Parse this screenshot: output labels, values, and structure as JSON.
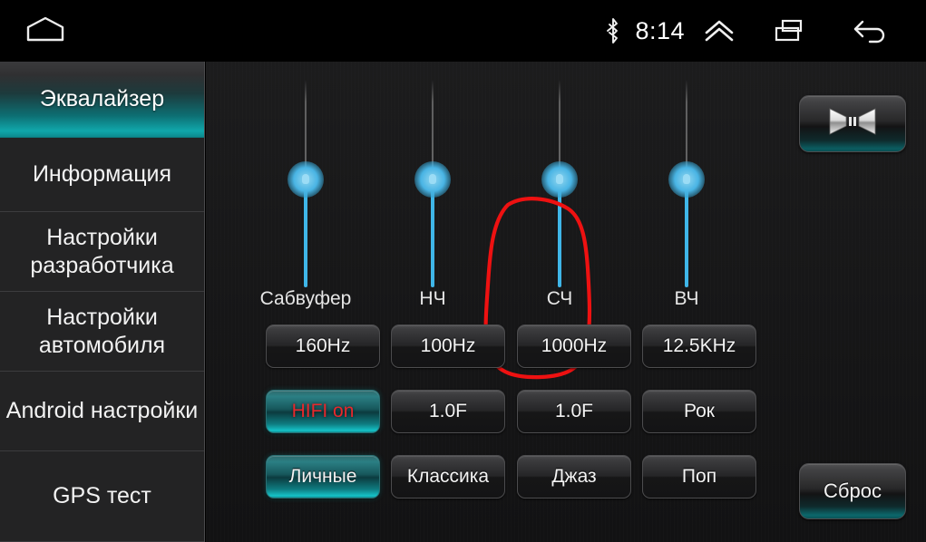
{
  "statusbar": {
    "home_icon": "home-icon",
    "bluetooth_icon": "bluetooth-icon",
    "time": "8:14",
    "expand_icon": "chevron-up-icon",
    "recents_icon": "recents-icon",
    "back_icon": "back-icon"
  },
  "sidebar": {
    "items": [
      {
        "label": "Эквалайзер",
        "active": true
      },
      {
        "label": "Информация",
        "active": false
      },
      {
        "label": "Настройки разработчика",
        "active": false
      },
      {
        "label": "Настройки автомобиля",
        "active": false
      },
      {
        "label": "Android настройки",
        "active": false
      },
      {
        "label": "GPS тест",
        "active": false
      }
    ]
  },
  "main": {
    "sliders": [
      {
        "label": "Сабвуфер",
        "annotated": true
      },
      {
        "label": "НЧ",
        "annotated": false
      },
      {
        "label": "СЧ",
        "annotated": false
      },
      {
        "label": "ВЧ",
        "annotated": false
      }
    ],
    "button_rows": [
      [
        {
          "label": "160Hz",
          "state": "normal"
        },
        {
          "label": "100Hz",
          "state": "normal"
        },
        {
          "label": "1000Hz",
          "state": "normal"
        },
        {
          "label": "12.5KHz",
          "state": "normal"
        }
      ],
      [
        {
          "label": "HIFI on",
          "state": "on-red"
        },
        {
          "label": "1.0F",
          "state": "normal"
        },
        {
          "label": "1.0F",
          "state": "normal"
        },
        {
          "label": "Рок",
          "state": "normal"
        }
      ],
      [
        {
          "label": "Личные",
          "state": "on"
        },
        {
          "label": "Классика",
          "state": "normal"
        },
        {
          "label": "Джаз",
          "state": "normal"
        },
        {
          "label": "Поп",
          "state": "normal"
        }
      ]
    ],
    "balance_button_icon": "speaker-balance-icon",
    "reset_label": "Сброс",
    "annotation_color": "#ee1111"
  },
  "colors": {
    "accent_teal": "#10a7ab",
    "slider_blue": "#3fb6e8",
    "hifi_red": "#e8282c",
    "panel_bg": "#161617",
    "sidebar_bg": "#232324"
  }
}
